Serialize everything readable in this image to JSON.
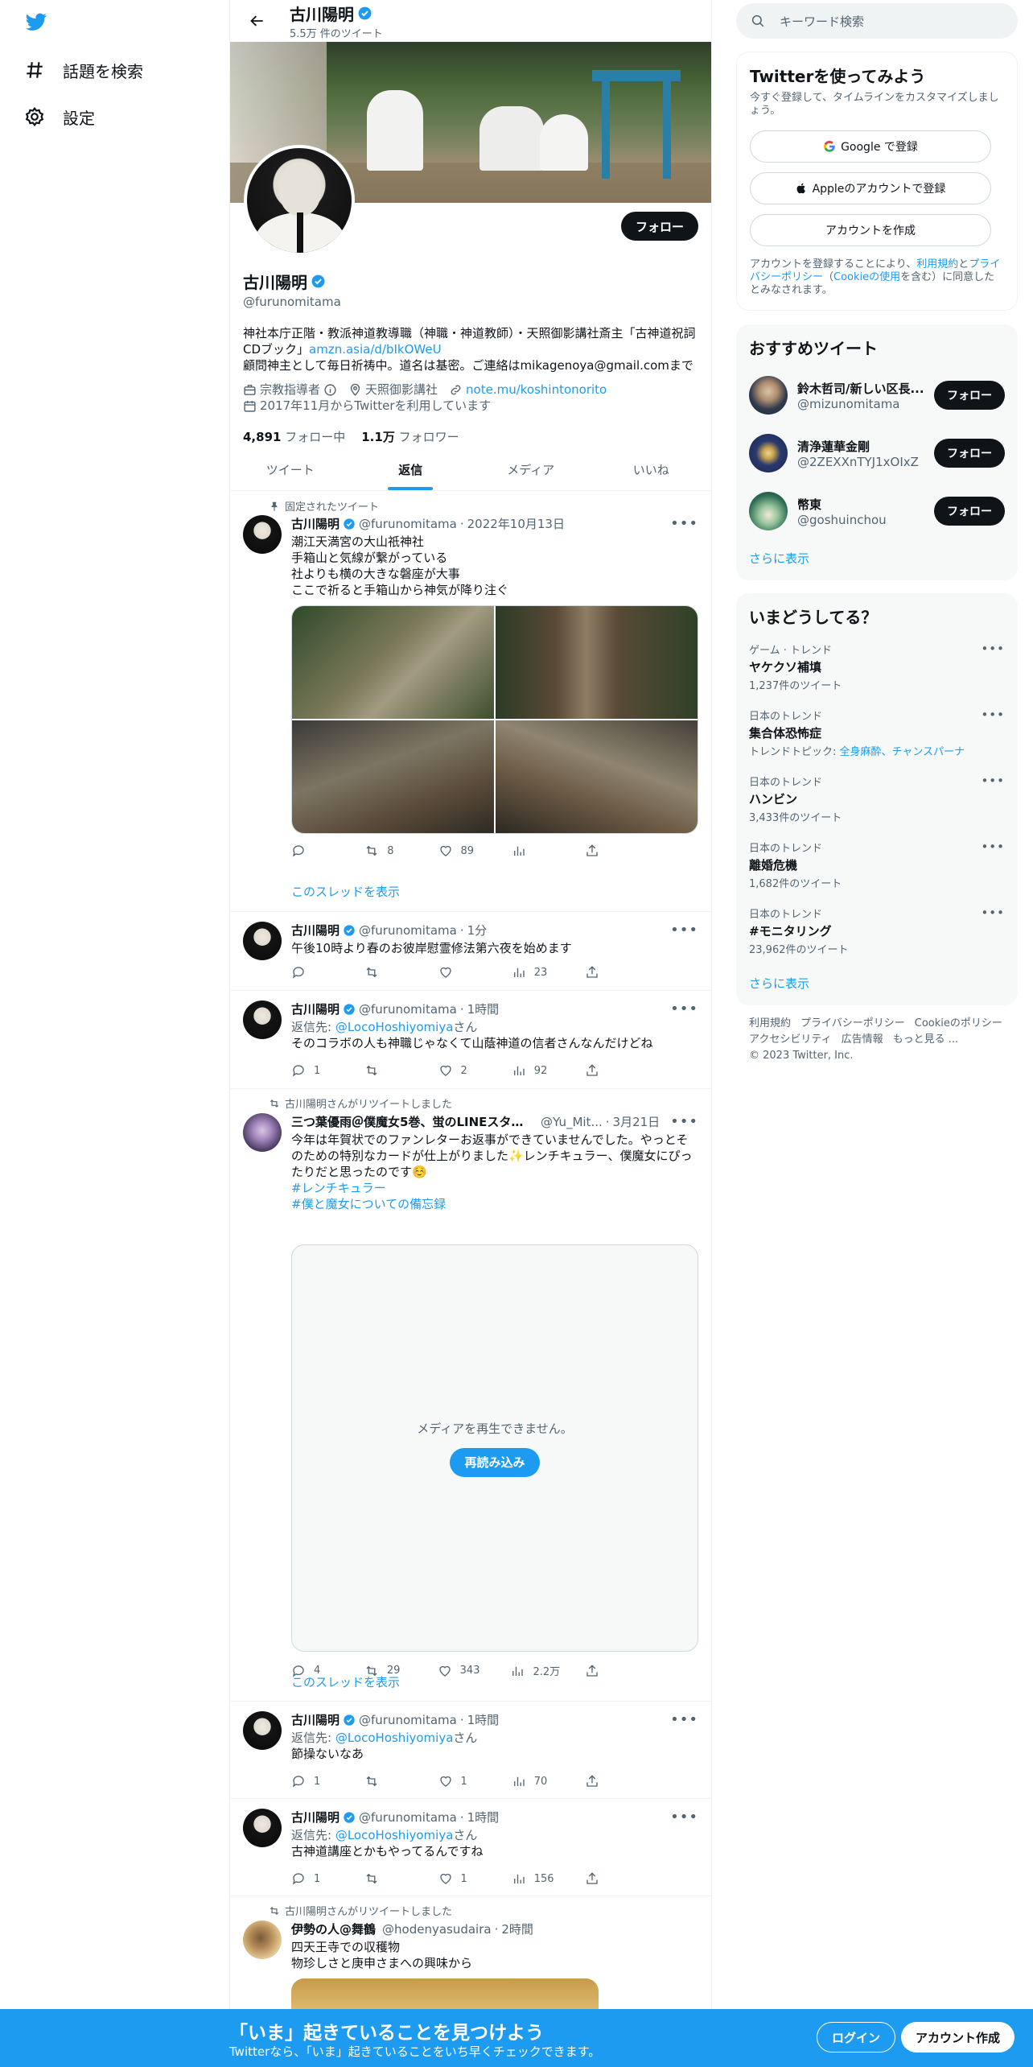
{
  "nav": {
    "explore": "話題を検索",
    "settings": "設定"
  },
  "header": {
    "name": "古川陽明",
    "tweet_count": "5.5万 件のツイート"
  },
  "profile": {
    "name": "古川陽明",
    "handle": "@furunomitama",
    "follow_label": "フォロー",
    "bio_line1": "神社本庁正階・教派神道教導職（神職・神道教師）・天照御影講社斎主「古神道祝詞CDブック」",
    "bio_link": "amzn.asia/d/bIkOWeU",
    "bio_line2": "顧問神主として毎日祈祷中。道名は基密。ご連絡はmikagenoya@gmail.comまで",
    "category": "宗教指導者",
    "location": "天照御影講社",
    "website": "note.mu/koshintonorito",
    "joined": "2017年11月からTwitterを利用しています",
    "following_count": "4,891",
    "following_label": "フォロー中",
    "followers_count": "1.1万",
    "followers_label": "フォロワー"
  },
  "tabs": [
    {
      "label": "ツイート"
    },
    {
      "label": "返信"
    },
    {
      "label": "メディア"
    },
    {
      "label": "いいね"
    }
  ],
  "tweets": [
    {
      "context": "固定されたツイート",
      "name": "古川陽明",
      "handle": "@furunomitama",
      "time": "2022年10月13日",
      "lines": [
        "潮江天満宮の大山祇神社",
        "手箱山と気線が繋がっている",
        "社よりも横の大きな磐座が大事",
        "ここで祈ると手箱山から神気が降り注ぐ"
      ],
      "replies": "",
      "retweets": "8",
      "likes": "89",
      "views": "",
      "show_thread": "このスレッドを表示"
    },
    {
      "name": "古川陽明",
      "handle": "@furunomitama",
      "time": "1分",
      "lines": [
        "午後10時より春のお彼岸慰霊修法第六夜を始めます"
      ],
      "replies": "",
      "retweets": "",
      "likes": "",
      "views": "23"
    },
    {
      "name": "古川陽明",
      "handle": "@furunomitama",
      "time": "1時間",
      "reply_prefix": "返信先:",
      "reply_to": "@LocoHoshiyomiya",
      "reply_suffix": "さん",
      "lines": [
        "そのコラボの人も神職じゃなくて山蔭神道の信者さんなんだけどね"
      ],
      "replies": "1",
      "retweets": "",
      "likes": "2",
      "views": "92"
    },
    {
      "context": "古川陽明さんがリツイートしました",
      "name": "三つ葉優雨＠僕魔女5巻、蛍のLINEスタンプ…",
      "handle": "@Yu_Mit...",
      "time": "3月21日",
      "lines": [
        "今年は年賀状でのファンレターお返事ができていませんでした。やっとそのための特別なカードが仕上がりました✨レンチキュラー、僕魔女にぴったりだと思ったのです☺️"
      ],
      "hashtag1": "#レンチキュラー",
      "hashtag2": "#僕と魔女についての備忘録",
      "media_error": "メディアを再生できません。",
      "reload": "再読み込み",
      "replies": "4",
      "retweets": "29",
      "likes": "343",
      "views": "2.2万",
      "show_thread": "このスレッドを表示"
    },
    {
      "name": "古川陽明",
      "handle": "@furunomitama",
      "time": "1時間",
      "reply_prefix": "返信先:",
      "reply_to": "@LocoHoshiyomiya",
      "reply_suffix": "さん",
      "lines": [
        "節操ないなあ"
      ],
      "replies": "1",
      "retweets": "",
      "likes": "1",
      "views": "70"
    },
    {
      "name": "古川陽明",
      "handle": "@furunomitama",
      "time": "1時間",
      "reply_prefix": "返信先:",
      "reply_to": "@LocoHoshiyomiya",
      "reply_suffix": "さん",
      "lines": [
        "古神道講座とかもやってるんですね"
      ],
      "replies": "1",
      "retweets": "",
      "likes": "1",
      "views": "156"
    },
    {
      "context": "古川陽明さんがリツイートしました",
      "name": "伊勢の人@舞鶴",
      "handle": "@hodenyasudaira",
      "time": "2時間",
      "lines": [
        "四天王寺での収穫物",
        "物珍しさと庚申さまへの興味から"
      ]
    }
  ],
  "right": {
    "search_placeholder": "キーワード検索",
    "signup": {
      "title": "Twitterを使ってみよう",
      "subtitle": "今すぐ登録して、タイムラインをカスタマイズしましょう。",
      "google": "Google で登録",
      "apple": "Appleのアカウントで登録",
      "create": "アカウントを作成",
      "note_a": "アカウントを登録することにより、",
      "note_terms": "利用規約",
      "note_b": "と",
      "note_privacy": "プライバシーポリシー",
      "note_c": "（",
      "note_cookie": "Cookieの使用",
      "note_d": "を含む）に同意したとみなされます。"
    },
    "recommend": {
      "title": "おすすめツイート",
      "users": [
        {
          "name": "鈴木哲司/新しい区長...",
          "handle": "@mizunomitama",
          "button": "フォロー"
        },
        {
          "name": "清浄蓮華金剛",
          "handle": "@2ZEXXnTYJ1xOIxZ",
          "button": "フォロー"
        },
        {
          "name": "幣東",
          "handle": "@goshuinchou",
          "button": "フォロー"
        }
      ],
      "more": "さらに表示"
    },
    "trends": {
      "title": "いまどうしてる？",
      "items": [
        {
          "category": "ゲーム · トレンド",
          "name": "ヤケクソ補填",
          "count": "1,237件のツイート"
        },
        {
          "category": "日本のトレンド",
          "name": "集合体恐怖症",
          "topic_label": "トレンドトピック:",
          "topic": "全身麻酔、チャンスパーナ"
        },
        {
          "category": "日本のトレンド",
          "name": "ハンビン",
          "count": "3,433件のツイート"
        },
        {
          "category": "日本のトレンド",
          "name": "離婚危機",
          "count": "1,682件のツイート"
        },
        {
          "category": "日本のトレンド",
          "name": "#モニタリング",
          "count": "23,962件のツイート"
        }
      ],
      "more": "さらに表示"
    },
    "footer": [
      "利用規約",
      "プライバシーポリシー",
      "Cookieのポリシー",
      "アクセシビリティ",
      "広告情報",
      "もっと見る ...",
      "© 2023 Twitter, Inc."
    ]
  },
  "bottom": {
    "title": "「いま」起きていることを見つけよう",
    "subtitle": "Twitterなら、「いま」起きていることをいち早くチェックできます。",
    "login": "ログイン",
    "signup": "アカウント作成"
  },
  "colors": {
    "accent": "#1d9bf0",
    "text": "#0f1419",
    "muted": "#536471"
  }
}
